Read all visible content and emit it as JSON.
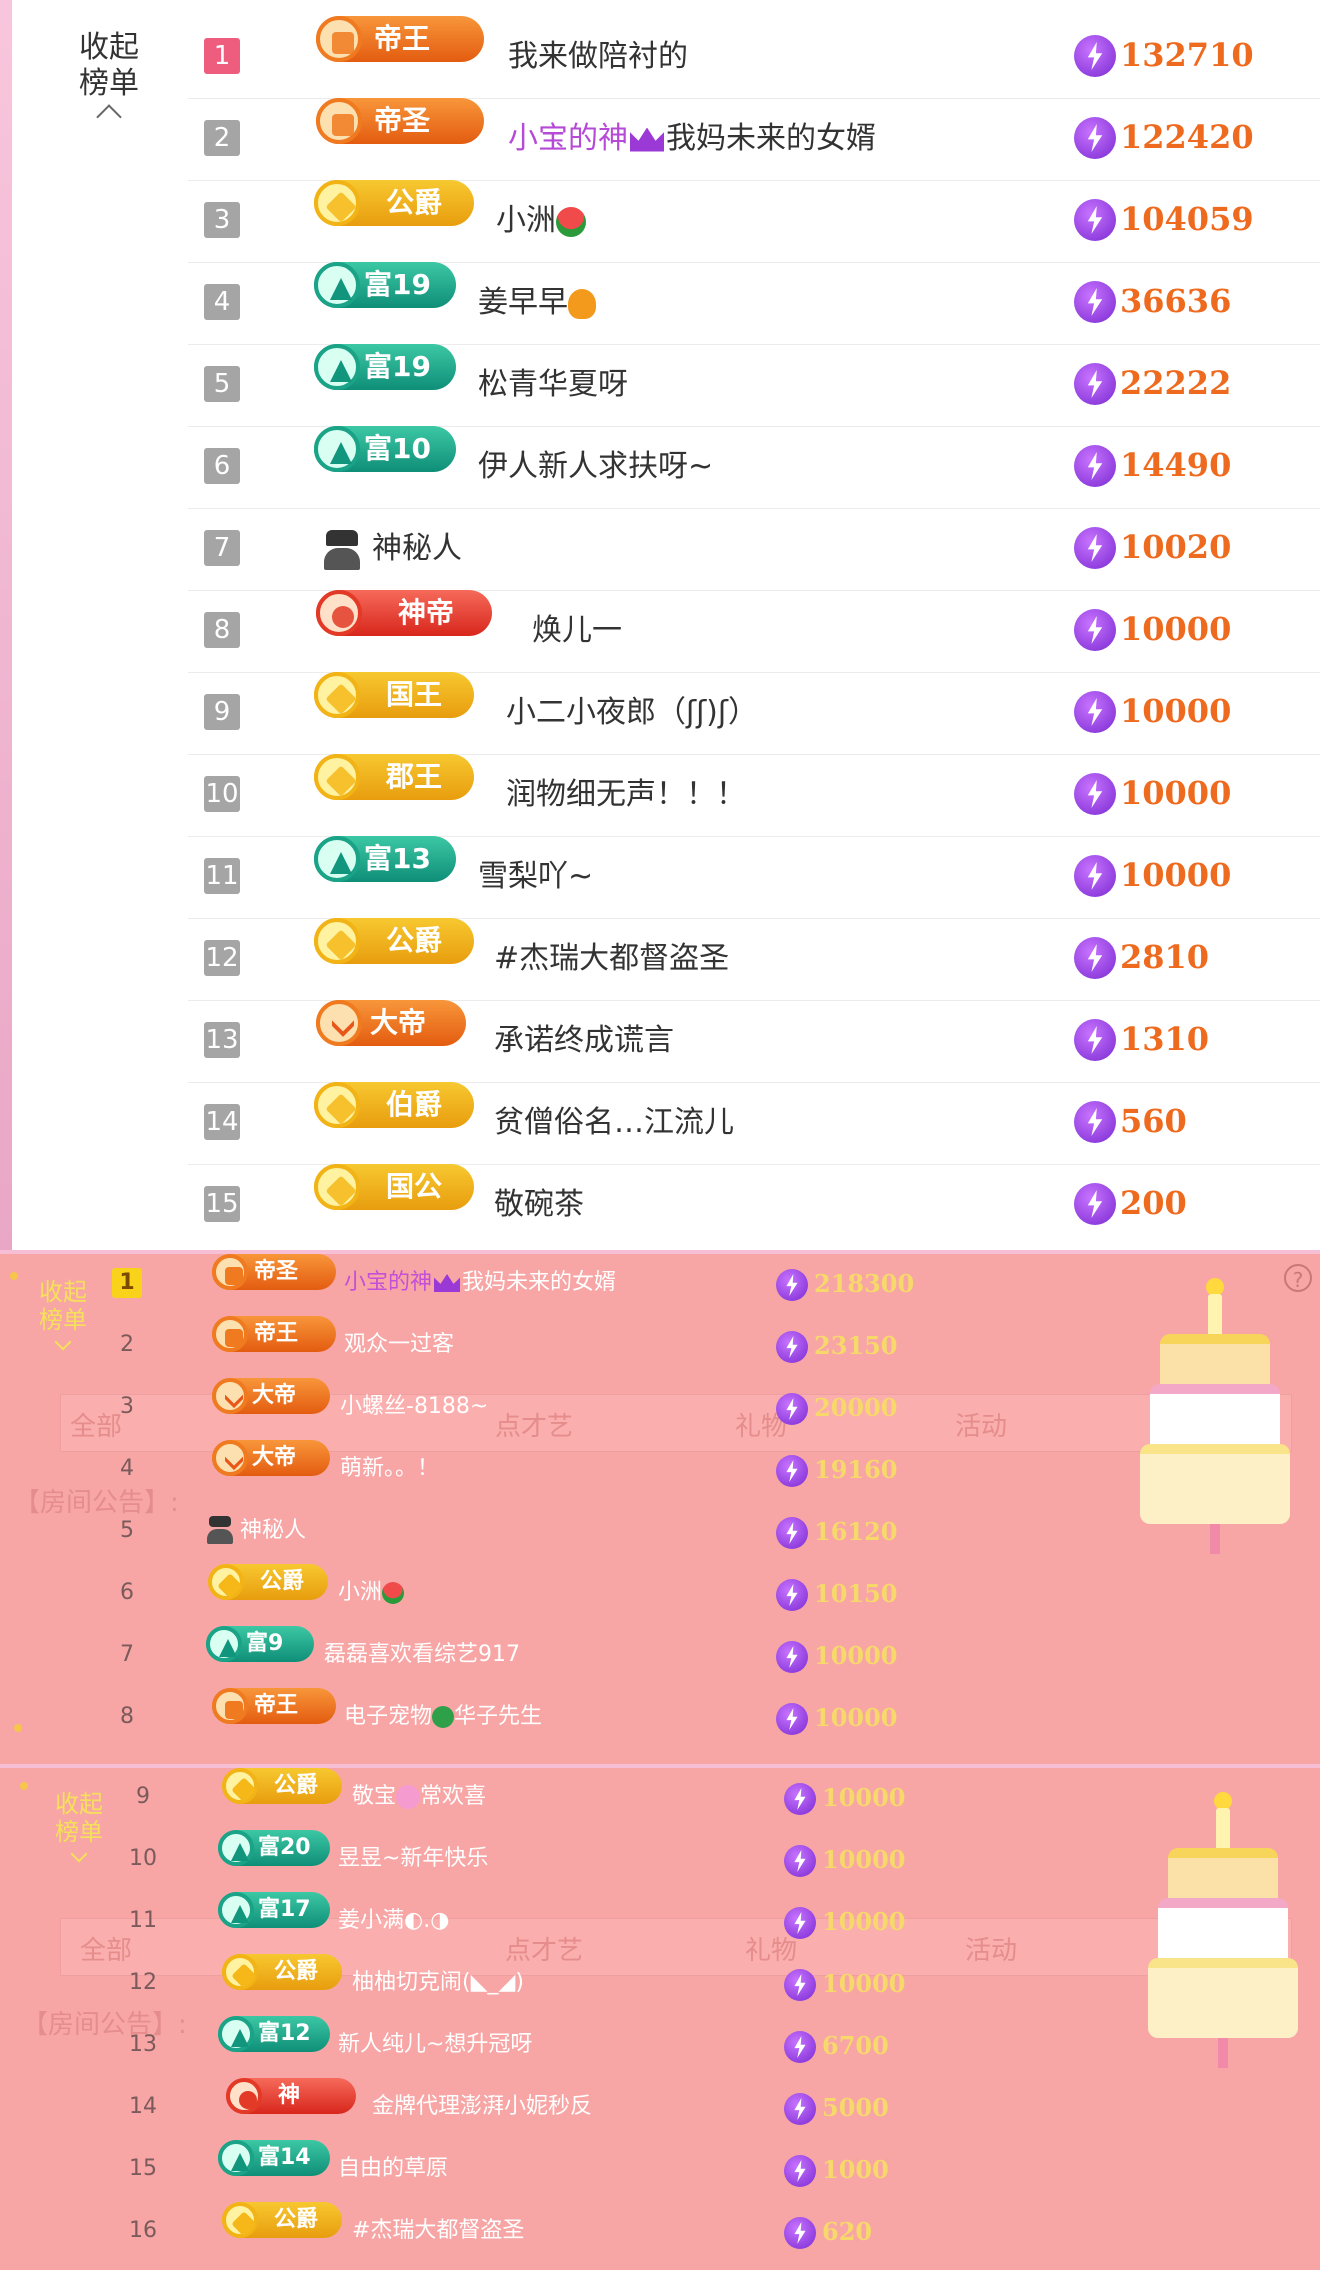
{
  "top": {
    "collapse_label_1": "收起",
    "collapse_label_2": "榜单",
    "rows": [
      {
        "rank": "1",
        "badge": "帝王",
        "name": "我来做陪衬的",
        "score": "132710"
      },
      {
        "rank": "2",
        "badge": "帝圣",
        "name_a": "小宝的神",
        "name_b": "我妈未来的女婿",
        "score": "122420"
      },
      {
        "rank": "3",
        "badge": "公爵",
        "name": "小洲",
        "score": "104059"
      },
      {
        "rank": "4",
        "badge": "富19",
        "name": "姜早早",
        "score": "36636"
      },
      {
        "rank": "5",
        "badge": "富19",
        "name": "松青华夏呀",
        "score": "22222"
      },
      {
        "rank": "6",
        "badge": "富10",
        "name": "伊人新人求扶呀~",
        "score": "14490"
      },
      {
        "rank": "7",
        "name": "神秘人",
        "score": "10020"
      },
      {
        "rank": "8",
        "badge": "神帝",
        "name": "焕儿一",
        "score": "10000"
      },
      {
        "rank": "9",
        "badge": "国王",
        "name": "小二小夜郎（ʃʃ)ʃ）",
        "score": "10000"
      },
      {
        "rank": "10",
        "badge": "郡王",
        "name": "润物细无声！！！",
        "score": "10000"
      },
      {
        "rank": "11",
        "badge": "富13",
        "name": "雪梨吖~",
        "score": "10000"
      },
      {
        "rank": "12",
        "badge": "公爵",
        "name": "#杰瑞大都督盗圣",
        "score": "2810"
      },
      {
        "rank": "13",
        "badge": "大帝",
        "name": "承诺终成谎言",
        "score": "1310"
      },
      {
        "rank": "14",
        "badge": "伯爵",
        "name": "贫僧俗名…江流儿",
        "score": "560"
      },
      {
        "rank": "15",
        "badge": "国公",
        "name": "敬碗茶",
        "score": "200"
      }
    ]
  },
  "pink1": {
    "collapse_label_1": "收起",
    "collapse_label_2": "榜单",
    "ghost_tabs": [
      "全部",
      "点才艺",
      "礼物",
      "活动"
    ],
    "ghost_notice": "【房间公告】:",
    "rows": [
      {
        "rank": "1",
        "badge": "帝圣",
        "name_a": "小宝的神",
        "name_b": "我妈未来的女婿",
        "score": "218300"
      },
      {
        "rank": "2",
        "badge": "帝王",
        "name": "观众一过客",
        "score": "23150"
      },
      {
        "rank": "3",
        "badge": "大帝",
        "name": "小螺丝-8188~",
        "score": "20000"
      },
      {
        "rank": "4",
        "badge": "大帝",
        "name": "萌新。。！",
        "score": "19160"
      },
      {
        "rank": "5",
        "name": "神秘人",
        "score": "16120"
      },
      {
        "rank": "6",
        "badge": "公爵",
        "name": "小洲",
        "score": "10150"
      },
      {
        "rank": "7",
        "badge": "富9",
        "name": "磊磊喜欢看综艺917",
        "score": "10000"
      },
      {
        "rank": "8",
        "badge": "帝王",
        "name_a": "电子宠物",
        "name_b": "华子先生",
        "score": "10000"
      }
    ]
  },
  "pink2": {
    "collapse_label_1": "收起",
    "collapse_label_2": "榜单",
    "ghost_tabs": [
      "全部",
      "点才艺",
      "礼物",
      "活动"
    ],
    "ghost_notice": "【房间公告】:",
    "rows": [
      {
        "rank": "9",
        "badge": "公爵",
        "name_a": "敬宝",
        "name_b": "常欢喜",
        "score": "10000"
      },
      {
        "rank": "10",
        "badge": "富20",
        "name": "昱昱~新年快乐",
        "score": "10000"
      },
      {
        "rank": "11",
        "badge": "富17",
        "name": "姜小满◐.◑",
        "score": "10000"
      },
      {
        "rank": "12",
        "badge": "公爵",
        "name": "柚柚切克闹(◣_◢)",
        "score": "10000"
      },
      {
        "rank": "13",
        "badge": "富12",
        "name": "新人纯儿~想升冠呀",
        "score": "6700"
      },
      {
        "rank": "14",
        "badge": "神",
        "name": "金牌代理澎湃小妮秒反",
        "score": "5000"
      },
      {
        "rank": "15",
        "badge": "富14",
        "name": "自由的草原",
        "score": "1000"
      },
      {
        "rank": "16",
        "badge": "公爵",
        "name": "#杰瑞大都督盗圣",
        "score": "620"
      }
    ]
  },
  "help_glyph": "?"
}
